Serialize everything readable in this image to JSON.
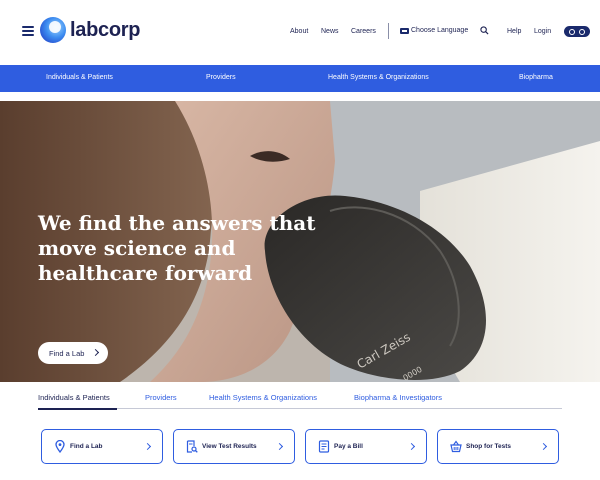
{
  "brand": {
    "name": "labcorp"
  },
  "utility_nav": {
    "about": "About",
    "news": "News",
    "careers": "Careers",
    "language": "Choose Language",
    "help": "Help",
    "login": "Login"
  },
  "main_nav": [
    "Individuals & Patients",
    "Providers",
    "Health Systems & Organizations",
    "Biopharma"
  ],
  "hero": {
    "title_lines": [
      "We find the answers that",
      "move science and",
      "healthcare forward"
    ],
    "button_label": "Find a Lab",
    "image_text": [
      "Carl Zeiss",
      "0000"
    ]
  },
  "tabs": [
    "Individuals & Patients",
    "Providers",
    "Health Systems & Organizations",
    "Biopharma & Investigators"
  ],
  "active_tab": "Individuals & Patients",
  "quick_links": [
    {
      "label": "Find a Lab",
      "icon": "location-pin-icon"
    },
    {
      "label": "View Test Results",
      "icon": "document-search-icon"
    },
    {
      "label": "Pay a Bill",
      "icon": "bill-icon"
    },
    {
      "label": "Shop for Tests",
      "icon": "shopping-basket-icon"
    }
  ],
  "colors": {
    "brand_blue": "#2f5de0",
    "navy": "#1d2252",
    "white": "#ffffff"
  }
}
